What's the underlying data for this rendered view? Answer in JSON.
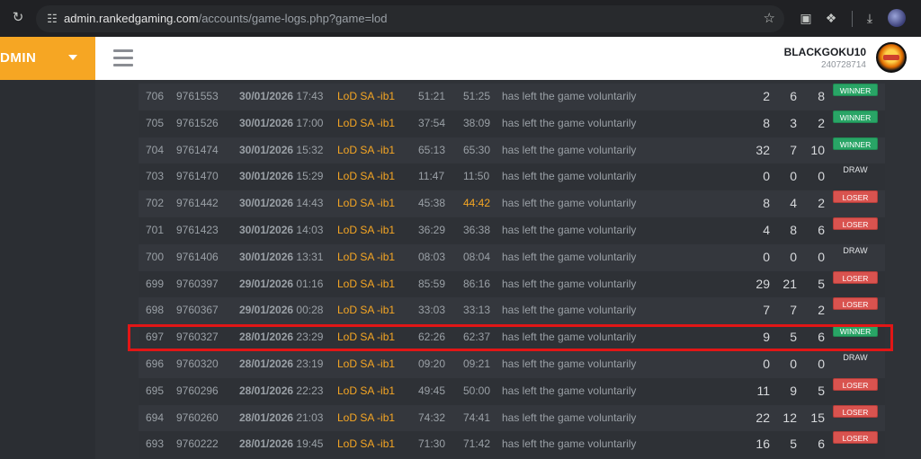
{
  "browser": {
    "url_host": "admin.rankedgaming.com",
    "url_path": "/accounts/game-logs.php?game=lod"
  },
  "header": {
    "brand": "DMIN",
    "username": "BLACKGOKU10",
    "user_id": "240728714"
  },
  "icons": {
    "reload": "reload-icon",
    "site_info": "tune-icon",
    "bookmark": "star-icon",
    "extensions": "puzzle-icon",
    "download": "download-icon",
    "menu": "hamburger-icon"
  },
  "colors": {
    "brand_orange": "#f6a623",
    "winner_green": "#29a566",
    "loser_red": "#d9534f",
    "highlight_red": "#e21616"
  },
  "logs": [
    {
      "num": "706",
      "id": "9761553",
      "date": "30/01/2026",
      "time": "17:43",
      "game": "LoD SA -ib1",
      "t1": "51:21",
      "t2": "51:25",
      "status": "has left the game voluntarily",
      "k": "2",
      "d": "6",
      "a": "8",
      "result": "WINNER"
    },
    {
      "num": "705",
      "id": "9761526",
      "date": "30/01/2026",
      "time": "17:00",
      "game": "LoD SA -ib1",
      "t1": "37:54",
      "t2": "38:09",
      "status": "has left the game voluntarily",
      "k": "8",
      "d": "3",
      "a": "2",
      "result": "WINNER"
    },
    {
      "num": "704",
      "id": "9761474",
      "date": "30/01/2026",
      "time": "15:32",
      "game": "LoD SA -ib1",
      "t1": "65:13",
      "t2": "65:30",
      "status": "has left the game voluntarily",
      "k": "32",
      "d": "7",
      "a": "10",
      "result": "WINNER"
    },
    {
      "num": "703",
      "id": "9761470",
      "date": "30/01/2026",
      "time": "15:29",
      "game": "LoD SA -ib1",
      "t1": "11:47",
      "t2": "11:50",
      "status": "has left the game voluntarily",
      "k": "0",
      "d": "0",
      "a": "0",
      "result": "DRAW"
    },
    {
      "num": "702",
      "id": "9761442",
      "date": "30/01/2026",
      "time": "14:43",
      "game": "LoD SA -ib1",
      "t1": "45:38",
      "t2": "44:42",
      "status": "has left the game voluntarily",
      "k": "8",
      "d": "4",
      "a": "2",
      "result": "LOSER"
    },
    {
      "num": "701",
      "id": "9761423",
      "date": "30/01/2026",
      "time": "14:03",
      "game": "LoD SA -ib1",
      "t1": "36:29",
      "t2": "36:38",
      "status": "has left the game voluntarily",
      "k": "4",
      "d": "8",
      "a": "6",
      "result": "LOSER"
    },
    {
      "num": "700",
      "id": "9761406",
      "date": "30/01/2026",
      "time": "13:31",
      "game": "LoD SA -ib1",
      "t1": "08:03",
      "t2": "08:04",
      "status": "has left the game voluntarily",
      "k": "0",
      "d": "0",
      "a": "0",
      "result": "DRAW"
    },
    {
      "num": "699",
      "id": "9760397",
      "date": "29/01/2026",
      "time": "01:16",
      "game": "LoD SA -ib1",
      "t1": "85:59",
      "t2": "86:16",
      "status": "has left the game voluntarily",
      "k": "29",
      "d": "21",
      "a": "5",
      "result": "LOSER"
    },
    {
      "num": "698",
      "id": "9760367",
      "date": "29/01/2026",
      "time": "00:28",
      "game": "LoD SA -ib1",
      "t1": "33:03",
      "t2": "33:13",
      "status": "has left the game voluntarily",
      "k": "7",
      "d": "7",
      "a": "2",
      "result": "LOSER"
    },
    {
      "num": "697",
      "id": "9760327",
      "date": "28/01/2026",
      "time": "23:29",
      "game": "LoD SA -ib1",
      "t1": "62:26",
      "t2": "62:37",
      "status": "has left the game voluntarily",
      "k": "9",
      "d": "5",
      "a": "6",
      "result": "WINNER"
    },
    {
      "num": "696",
      "id": "9760320",
      "date": "28/01/2026",
      "time": "23:19",
      "game": "LoD SA -ib1",
      "t1": "09:20",
      "t2": "09:21",
      "status": "has left the game voluntarily",
      "k": "0",
      "d": "0",
      "a": "0",
      "result": "DRAW"
    },
    {
      "num": "695",
      "id": "9760296",
      "date": "28/01/2026",
      "time": "22:23",
      "game": "LoD SA -ib1",
      "t1": "49:45",
      "t2": "50:00",
      "status": "has left the game voluntarily",
      "k": "11",
      "d": "9",
      "a": "5",
      "result": "LOSER"
    },
    {
      "num": "694",
      "id": "9760260",
      "date": "28/01/2026",
      "time": "21:03",
      "game": "LoD SA -ib1",
      "t1": "74:32",
      "t2": "74:41",
      "status": "has left the game voluntarily",
      "k": "22",
      "d": "12",
      "a": "15",
      "result": "LOSER"
    },
    {
      "num": "693",
      "id": "9760222",
      "date": "28/01/2026",
      "time": "19:45",
      "game": "LoD SA -ib1",
      "t1": "71:30",
      "t2": "71:42",
      "status": "has left the game voluntarily",
      "k": "16",
      "d": "5",
      "a": "6",
      "result": "LOSER"
    }
  ]
}
